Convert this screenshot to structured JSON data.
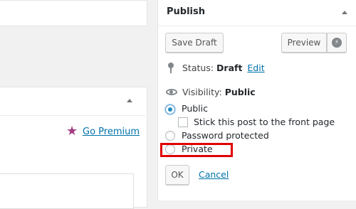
{
  "left": {
    "go_premium_label": "Go Premium",
    "star_icon": "star-icon"
  },
  "publish": {
    "title": "Publish",
    "save_draft_label": "Save Draft",
    "preview_label": "Preview",
    "bolt_icon": "⚡",
    "status_label": "Status:",
    "status_value": "Draft",
    "status_edit_label": "Edit",
    "visibility_label": "Visibility:",
    "visibility_value": "Public",
    "options": {
      "public": "Public",
      "sticky": "Stick this post to the front page",
      "password": "Password protected",
      "private": "Private"
    },
    "selected_option": "Public",
    "ok_label": "OK",
    "cancel_label": "Cancel"
  },
  "colors": {
    "link": "#0073aa",
    "highlight": "#e00000",
    "premium_star": "#a23a84"
  }
}
